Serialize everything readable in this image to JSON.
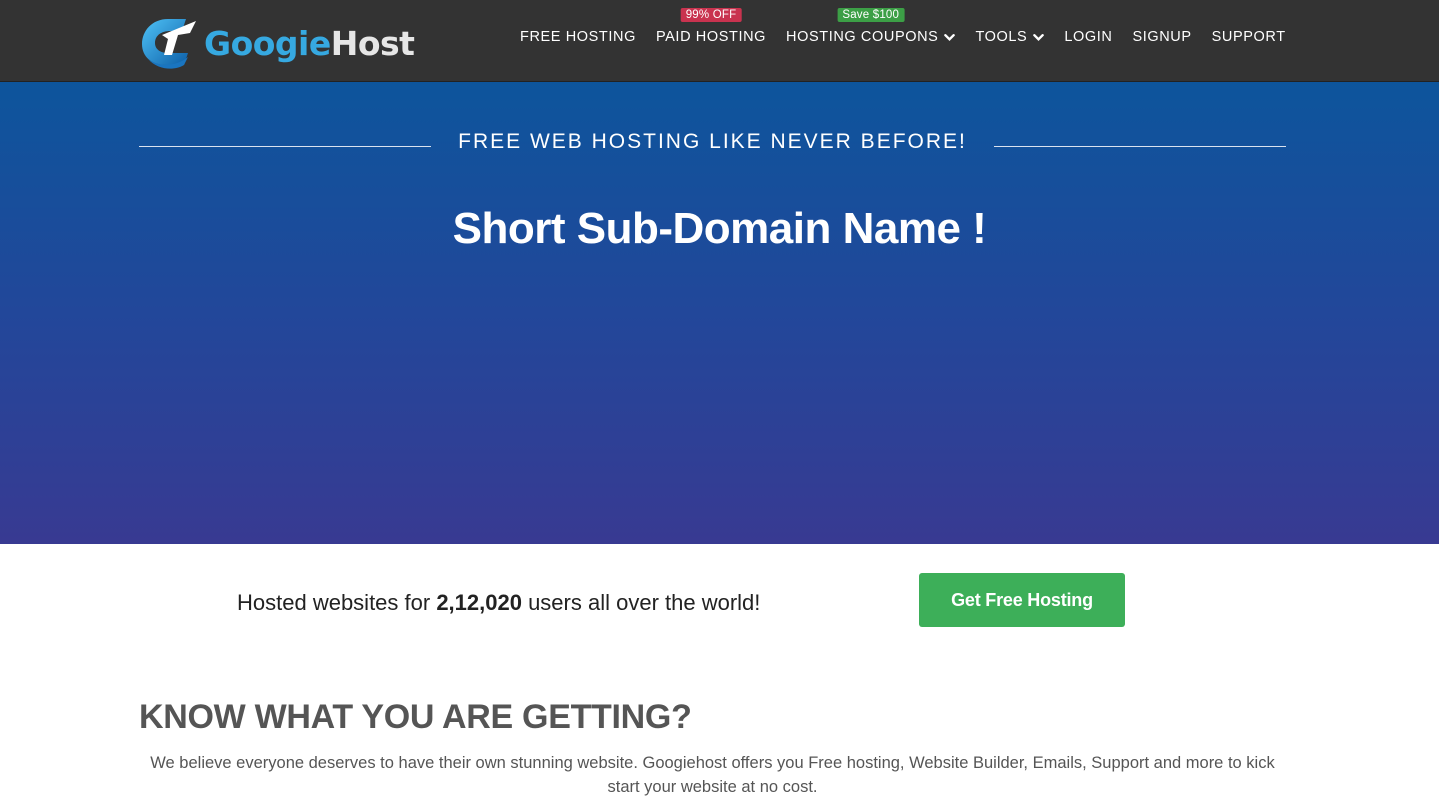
{
  "brand": {
    "name_part1": "Googie",
    "name_part2": "Host"
  },
  "nav": {
    "items": [
      {
        "label": "FREE HOSTING"
      },
      {
        "label": "PAID HOSTING",
        "badge": "99% OFF"
      },
      {
        "label": "HOSTING COUPONS",
        "badge": "Save $100"
      },
      {
        "label": "TOOLS"
      },
      {
        "label": "LOGIN"
      },
      {
        "label": "SIGNUP"
      },
      {
        "label": "SUPPORT"
      }
    ]
  },
  "hero": {
    "tagline": "FREE WEB HOSTING LIKE NEVER BEFORE!",
    "title": "Short Sub-Domain Name !"
  },
  "stats": {
    "prefix": "Hosted websites for ",
    "count": "2,12,020",
    "suffix": " users all over the world!"
  },
  "cta": {
    "label": "Get Free Hosting"
  },
  "know": {
    "title": "KNOW WHAT YOU ARE GETTING?",
    "text": "We believe everyone deserves to have their own stunning website. Googiehost offers you Free hosting, Website Builder, Emails, Support and more to kick start your website at no cost."
  },
  "colors": {
    "header_bg": "#333333",
    "hero_top": "#0d559c",
    "hero_bottom": "#383a92",
    "cta_bg": "#3daf59",
    "badge_red": "#c9334f",
    "badge_green": "#3c9f46"
  },
  "icons": [
    "googiehost-logo-icon",
    "chevron-down-icon"
  ]
}
